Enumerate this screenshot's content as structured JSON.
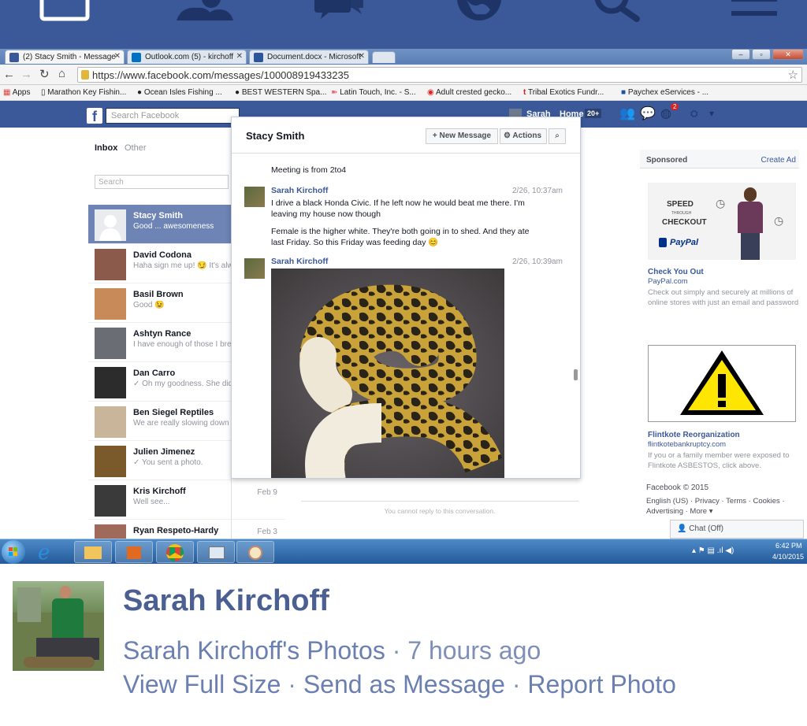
{
  "mobile_topbar": {
    "icons": [
      "home-icon",
      "friends-icon",
      "messages-icon",
      "globe-icon",
      "search-icon",
      "menu-icon"
    ],
    "background": "#3b5998"
  },
  "browser": {
    "tabs": [
      {
        "label": "(2) Stacy Smith - Message",
        "favicon": "facebook-favicon",
        "active": true
      },
      {
        "label": "Outlook.com (5) - kirchoff",
        "favicon": "outlook-favicon",
        "active": false
      },
      {
        "label": "Document.docx - Microsoft",
        "favicon": "word-favicon",
        "active": false
      }
    ],
    "url": "https://www.facebook.com/messages/100008919433235",
    "bookmarks": [
      "Apps",
      "Marathon Key Fishin...",
      "Ocean Isles Fishing ...",
      "BEST WESTERN Spa...",
      "Latin Touch, Inc. - S...",
      "Adult crested gecko...",
      "Tribal Exotics Fundr...",
      "Paychex eServices - ..."
    ]
  },
  "facebook": {
    "search_placeholder": "Search Facebook",
    "header_user": "Sarah",
    "header_home": "Home",
    "header_home_badge": "20+",
    "notif_badge": "2",
    "inbox_tab": "Inbox",
    "other_tab": "Other",
    "thread_search_placeholder": "Search",
    "threads": [
      {
        "name": "Stacy Smith",
        "snippet": "Good ... awesomeness",
        "date": "",
        "selected": true
      },
      {
        "name": "David Codona",
        "snippet": "Haha sign me up! 😏 It's alw",
        "date": ""
      },
      {
        "name": "Basil Brown",
        "snippet": "Good 😉",
        "date": ""
      },
      {
        "name": "Ashtyn Rance",
        "snippet": "I have enough of those I bre",
        "date": ""
      },
      {
        "name": "Dan Carro",
        "snippet": "✓ Oh my goodness. She did",
        "date": ""
      },
      {
        "name": "Ben Siegel Reptiles",
        "snippet": "We are really slowing down",
        "date": ""
      },
      {
        "name": "Julien Jimenez",
        "snippet": "✓ You sent a photo.",
        "date": ""
      },
      {
        "name": "Kris Kirchoff",
        "snippet": "Well see...",
        "date": "Feb 9"
      },
      {
        "name": "Ryan Respeto-Hardy",
        "snippet": "",
        "date": "Feb 3"
      }
    ],
    "conversation": {
      "title": "Stacy Smith",
      "new_message": "+ New Message",
      "actions": "Actions",
      "messages": [
        {
          "sender": "",
          "text": "Meeting is from 2to4",
          "time": ""
        },
        {
          "sender": "Sarah Kirchoff",
          "time": "2/26, 10:37am",
          "text": "I drive a black Honda Civic. If he left now he would beat me there. I'm leaving my house now though",
          "text2": "Female is the higher white. They're both going in to shed. And they ate last Friday. So this Friday was feeding day 😊"
        },
        {
          "sender": "Sarah Kirchoff",
          "time": "2/26, 10:39am",
          "text": ""
        }
      ],
      "cannot_reply": "You cannot reply to this conversation."
    },
    "sponsored": {
      "label": "Sponsored",
      "create_ad": "Create Ad",
      "ad1": {
        "banner_speed": "SPEED",
        "banner_through": "THROUGH",
        "banner_checkout": "CHECKOUT",
        "banner_brand": "PayPal",
        "title": "Check You Out",
        "domain": "PayPal.com",
        "body": "Check out simply and securely at millions of online stores with just an email and password"
      },
      "ad2": {
        "title": "Flintkote Reorganization",
        "domain": "flintkotebankruptcy.com",
        "body": "If you or a family member were exposed to Flintkote ASBESTOS, click above."
      }
    },
    "footer": {
      "copyright": "Facebook © 2015",
      "links": "English (US) · Privacy · Terms · Cookies · Advertising · More ▾"
    },
    "chat_label": "Chat (Off)"
  },
  "taskbar": {
    "time": "6:42 PM",
    "date": "4/10/2015"
  },
  "caption": {
    "name": "Sarah Kirchoff",
    "album": "Sarah Kirchoff's Photos",
    "time_ago": "7 hours ago",
    "view_full": "View Full Size",
    "send_msg": "Send as Message",
    "report": "Report Photo",
    "separator": "·"
  }
}
